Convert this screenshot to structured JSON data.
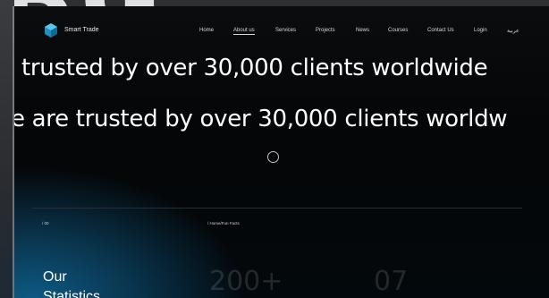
{
  "background": {
    "ghost_text": "BG",
    "base_color": "#2d2f33"
  },
  "header": {
    "brand": "Smart Trade",
    "logo_icon": "hexagon-logo-icon",
    "nav": [
      {
        "label": "Home"
      },
      {
        "label": "About us",
        "active": true
      },
      {
        "label": "Services"
      },
      {
        "label": "Projects"
      },
      {
        "label": "News"
      },
      {
        "label": "Courses"
      },
      {
        "label": "Contact Us"
      },
      {
        "label": "Login"
      },
      {
        "label": "عربية"
      }
    ]
  },
  "hero": {
    "marquee_line_1": "trusted by over 30,000 clients worldwide",
    "marquee_line_2": "e are trusted by over 30,000 clients worldw",
    "loader_icon": "circle-loader-icon"
  },
  "statistics": {
    "index_tag": "/ 00",
    "breadcrumb": "/ Home/Fun Facts",
    "title_line_1": "Our",
    "title_line_2": "Statistics",
    "stat_1": "200+",
    "stat_2": "07"
  },
  "colors": {
    "accent_glow": "#0e5b86",
    "window_bg": "#050607",
    "text": "#ffffff"
  }
}
